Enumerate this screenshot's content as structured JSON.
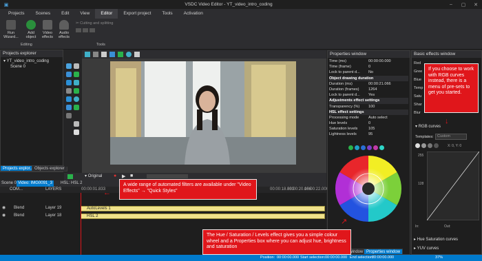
{
  "app": {
    "title": "VSDC Video Editor - YT_video_intro_coding"
  },
  "menu": [
    "Projects",
    "Scenes",
    "Edit",
    "View",
    "Editor",
    "Export project",
    "Tools",
    "Activation"
  ],
  "ribbon": {
    "run": "Run\nWizard...",
    "add": "Add\nobject",
    "video": "Video\neffects",
    "audio": "Audio\neffects",
    "cutting": "Cutting and splitting",
    "editing": "Editing",
    "tools": "Tools"
  },
  "projects": {
    "title": "Projects explorer",
    "project": "YT_video_intro_coding",
    "scene": "Scene 0",
    "tab1": "Projects explor...",
    "tab2": "Objects explorer"
  },
  "timeline": {
    "tabs": [
      "Scene 0",
      "Video: IMG0091_3",
      "HSL: HSL 2"
    ],
    "preview": "Original",
    "hdr": "COM...",
    "layers_label": "LAYERS",
    "time1": "00:00:01.833",
    "time2": "00:00:18.333",
    "time3": "00:00:20.166",
    "time4": "00:00:22.000",
    "rows": [
      {
        "mode": "Blend",
        "layer": "Layer 19",
        "clip": "AutoLevels 1"
      },
      {
        "mode": "Blend",
        "layer": "Layer 18",
        "clip": "HSL 2"
      }
    ]
  },
  "properties": {
    "title": "Properties window",
    "rows": [
      {
        "k": "Time (ms)",
        "v": "00:00:00.000"
      },
      {
        "k": "Time (frame)",
        "v": "0"
      },
      {
        "k": "Lock to parent d...",
        "v": "No"
      },
      {
        "k": "Object drawing duration",
        "v": "",
        "sec": true
      },
      {
        "k": "Duration (ms)",
        "v": "00:00:21.066"
      },
      {
        "k": "Duration (frames)",
        "v": "1264"
      },
      {
        "k": "Lock to parent d...",
        "v": "Yes"
      },
      {
        "k": "Adjustments effect settings",
        "v": "",
        "sec": true
      },
      {
        "k": "Transparency (%)",
        "v": "100"
      },
      {
        "k": "HSL effect settings",
        "v": "",
        "sec": true
      },
      {
        "k": "Processing mode",
        "v": "Auto select"
      },
      {
        "k": "Hue levels",
        "v": "0"
      },
      {
        "k": "Saturation levels",
        "v": "105"
      },
      {
        "k": "Lightness levels",
        "v": "95"
      }
    ],
    "swatches": [
      "#2ab24b",
      "#1fa0c8",
      "#2a6fd6",
      "#7b3fc9",
      "#c23aa8",
      "#2ed6c7"
    ],
    "tabs": [
      "Resource window",
      "Properties window"
    ]
  },
  "basic": {
    "title": "Basic effects window",
    "labels": [
      "Red",
      "Gree",
      "Blue",
      "Temp",
      "Satu",
      "Shar",
      "Blur"
    ],
    "rgb": "RGB curves",
    "templates_label": "Templates:",
    "template_val": "Custom",
    "coords": "X: 0, Y: 0",
    "y_top": "255",
    "y_mid": "128",
    "in_label": "In:",
    "out_label": "Out:",
    "hue_sat": "Hue Saturation curves",
    "yuv": "YUV curves"
  },
  "notes": {
    "rgb": "If you choose to work with RGB curves instead, there is a menu of pre-sets to get you started.",
    "filters": "A wide range of automated filters are available under \"Video Effects\" → \"Quick Styles\"",
    "hue": "The Hue / Saturation / Levels effect gives you a simple colour wheel and a Properties box where you can adjust hue, brightness and saturation"
  },
  "status": {
    "position": "Position:",
    "pos_val": "00:00:00.000",
    "start": "Start selection:",
    "start_val": "00:00:00.000",
    "end": "End selection:",
    "end_val": "00:00:00.000",
    "zoom": "37%"
  },
  "colors": {
    "accent": "#007acc",
    "note": "#e0161b",
    "clip": "#f0e28a"
  }
}
